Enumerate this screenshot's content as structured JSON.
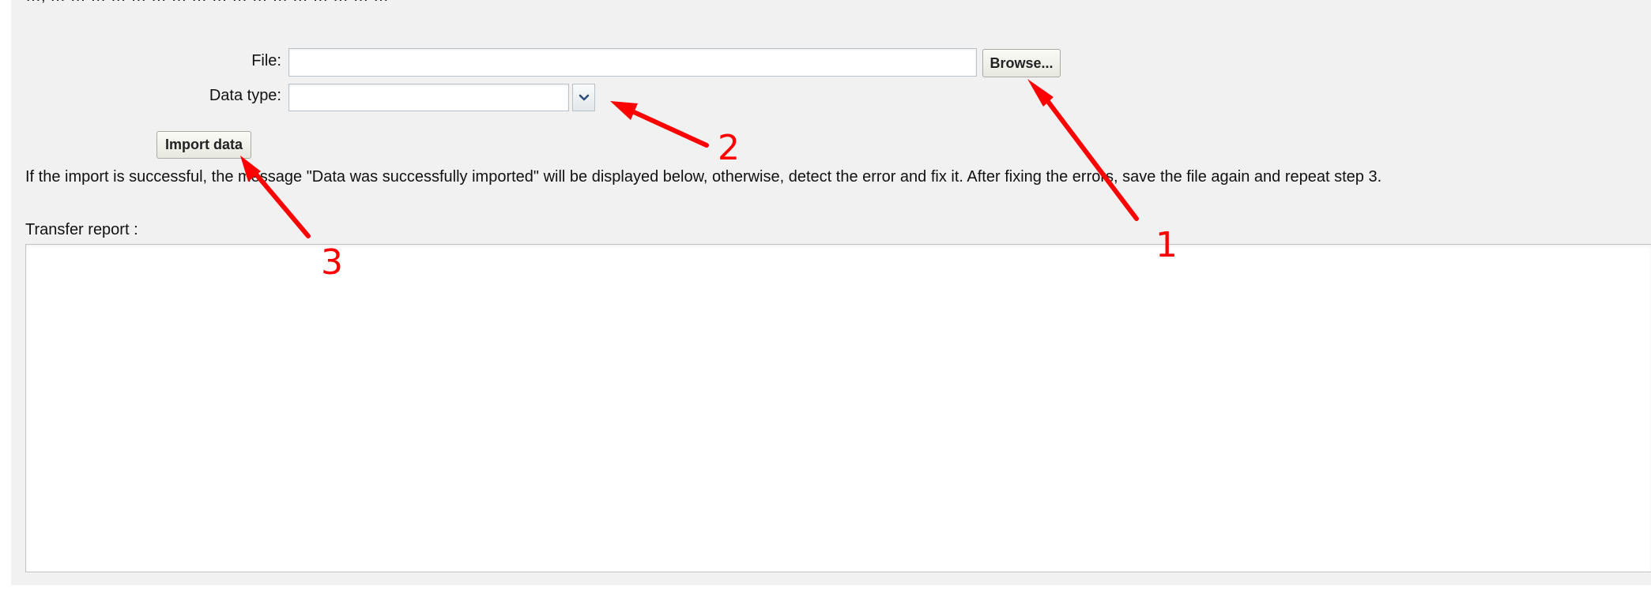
{
  "header": {
    "cut_off_text": "…, … … … … … … … … … … … … … … … … …"
  },
  "form": {
    "file_label": "File:",
    "file_value": "",
    "browse_label": "Browse...",
    "data_type_label": "Data type:",
    "data_type_value": "",
    "import_label": "Import data"
  },
  "info_text": "If the import is successful, the message \"Data was successfully imported\" will be displayed below, otherwise, detect the error and fix it. After fixing the errors, save the file again and repeat step 3.",
  "report": {
    "label": "Transfer report :",
    "content": ""
  },
  "annotations": {
    "color": "#ff0000",
    "items": [
      {
        "number": "1",
        "target": "browse-button"
      },
      {
        "number": "2",
        "target": "data-type-dropdown"
      },
      {
        "number": "3",
        "target": "import-data-button"
      }
    ]
  },
  "icons": {
    "dropdown": "chevron-down-icon"
  }
}
